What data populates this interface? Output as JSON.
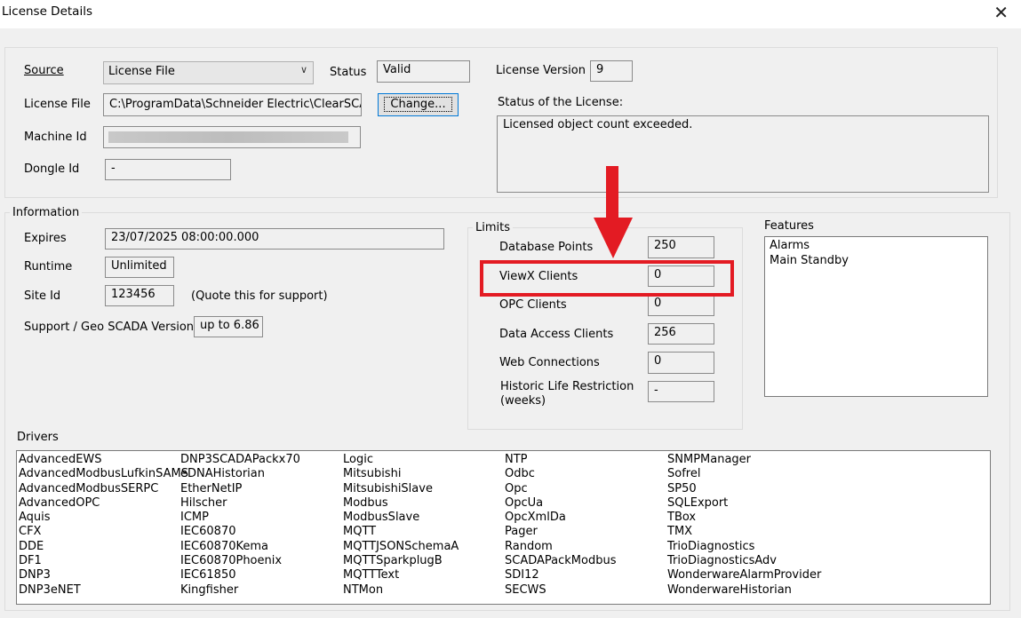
{
  "window": {
    "title": "License Details"
  },
  "license": {
    "source_label": "Source",
    "source_value": "License File",
    "status_label": "Status",
    "status_value": "Valid",
    "version_label": "License Version",
    "version_value": "9",
    "file_label": "License File",
    "file_value": "C:\\ProgramData\\Schneider Electric\\ClearSCAD",
    "change_button": "Change...",
    "status_of_license_label": "Status of the License:",
    "status_of_license_text": "Licensed object count exceeded.",
    "machine_id_label": "Machine Id",
    "dongle_id_label": "Dongle Id",
    "dongle_id_value": "-"
  },
  "information": {
    "title": "Information",
    "expires_label": "Expires",
    "expires_value": "23/07/2025 08:00:00.000",
    "runtime_label": "Runtime",
    "runtime_value": "Unlimited",
    "site_id_label": "Site Id",
    "site_id_value": "123456",
    "site_id_note": "(Quote this for support)",
    "support_label": "Support / Geo SCADA Version",
    "support_value": "up to 6.86"
  },
  "limits": {
    "title": "Limits",
    "items": [
      {
        "label": "Database Points",
        "value": "250"
      },
      {
        "label": "ViewX Clients",
        "value": "0"
      },
      {
        "label": "OPC Clients",
        "value": "0"
      },
      {
        "label": "Data Access Clients",
        "value": "256"
      },
      {
        "label": "Web Connections",
        "value": "0"
      },
      {
        "label": "Historic Life Restriction",
        "label2": "(weeks)",
        "value": "-"
      }
    ]
  },
  "features": {
    "title": "Features",
    "items": [
      "Alarms",
      "Main Standby"
    ]
  },
  "drivers": {
    "title": "Drivers",
    "columns": [
      [
        "AdvancedEWS",
        "AdvancedModbusLufkinSAMS",
        "AdvancedModbusSERPC",
        "AdvancedOPC",
        "Aquis",
        "CFX",
        "DDE",
        "DF1",
        "DNP3",
        "DNP3eNET"
      ],
      [
        "DNP3SCADAPackx70",
        "eDNAHistorian",
        "EtherNetIP",
        "Hilscher",
        "ICMP",
        "IEC60870",
        "IEC60870Kema",
        "IEC60870Phoenix",
        "IEC61850",
        "Kingfisher"
      ],
      [
        "Logic",
        "Mitsubishi",
        "MitsubishiSlave",
        "Modbus",
        "ModbusSlave",
        "MQTT",
        "MQTTJSONSchemaA",
        "MQTTSparkplugB",
        "MQTTText",
        "NTMon"
      ],
      [
        "NTP",
        "Odbc",
        "Opc",
        "OpcUa",
        "OpcXmlDa",
        "Pager",
        "Random",
        "SCADAPackModbus",
        "SDI12",
        "SECWS"
      ],
      [
        "SNMPManager",
        "Sofrel",
        "SP50",
        "SQLExport",
        "TBox",
        "TMX",
        "TrioDiagnostics",
        "TrioDiagnosticsAdv",
        "WonderwareAlarmProvider",
        "WonderwareHistorian"
      ]
    ]
  },
  "annotation": {
    "color": "#e31b23"
  }
}
